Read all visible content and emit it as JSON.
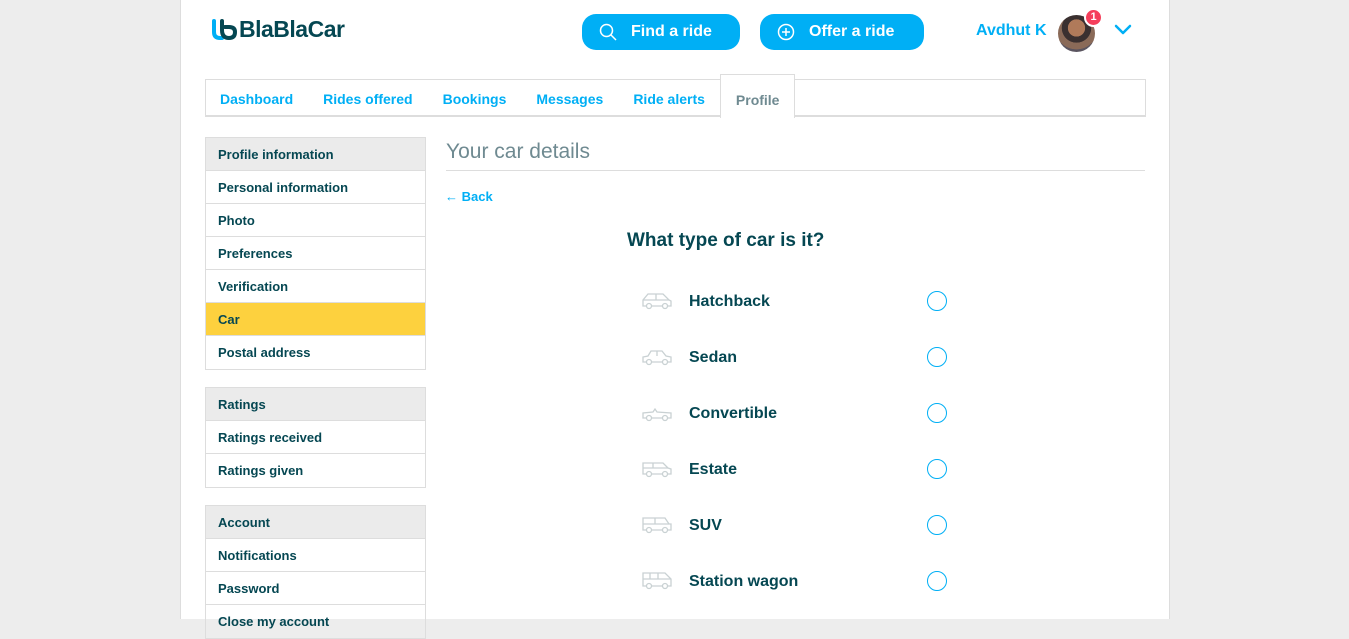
{
  "header": {
    "logo_text": "BlaBlaCar",
    "find_ride_label": "Find a ride",
    "offer_ride_label": "Offer a ride",
    "user_name": "Avdhut K",
    "notification_count": "1",
    "brand_color": "#00aff5"
  },
  "tabs": [
    {
      "label": "Dashboard"
    },
    {
      "label": "Rides offered"
    },
    {
      "label": "Bookings"
    },
    {
      "label": "Messages"
    },
    {
      "label": "Ride alerts"
    },
    {
      "label": "Profile"
    }
  ],
  "sidebar": {
    "profile_section": {
      "title": "Profile information",
      "items": [
        "Personal information",
        "Photo",
        "Preferences",
        "Verification",
        "Car",
        "Postal address"
      ]
    },
    "ratings_section": {
      "title": "Ratings",
      "items": [
        "Ratings received",
        "Ratings given"
      ]
    },
    "account_section": {
      "title": "Account",
      "items": [
        "Notifications",
        "Password",
        "Close my account"
      ]
    },
    "active_color": "#fdd13e"
  },
  "main": {
    "title": "Your car details",
    "back_label": "← Back",
    "question": "What type of car is it?",
    "options": [
      {
        "label": "Hatchback",
        "icon": "hatchback-icon"
      },
      {
        "label": "Sedan",
        "icon": "sedan-icon"
      },
      {
        "label": "Convertible",
        "icon": "convertible-icon"
      },
      {
        "label": "Estate",
        "icon": "estate-icon"
      },
      {
        "label": "SUV",
        "icon": "suv-icon"
      },
      {
        "label": "Station wagon",
        "icon": "station-wagon-icon"
      }
    ]
  }
}
